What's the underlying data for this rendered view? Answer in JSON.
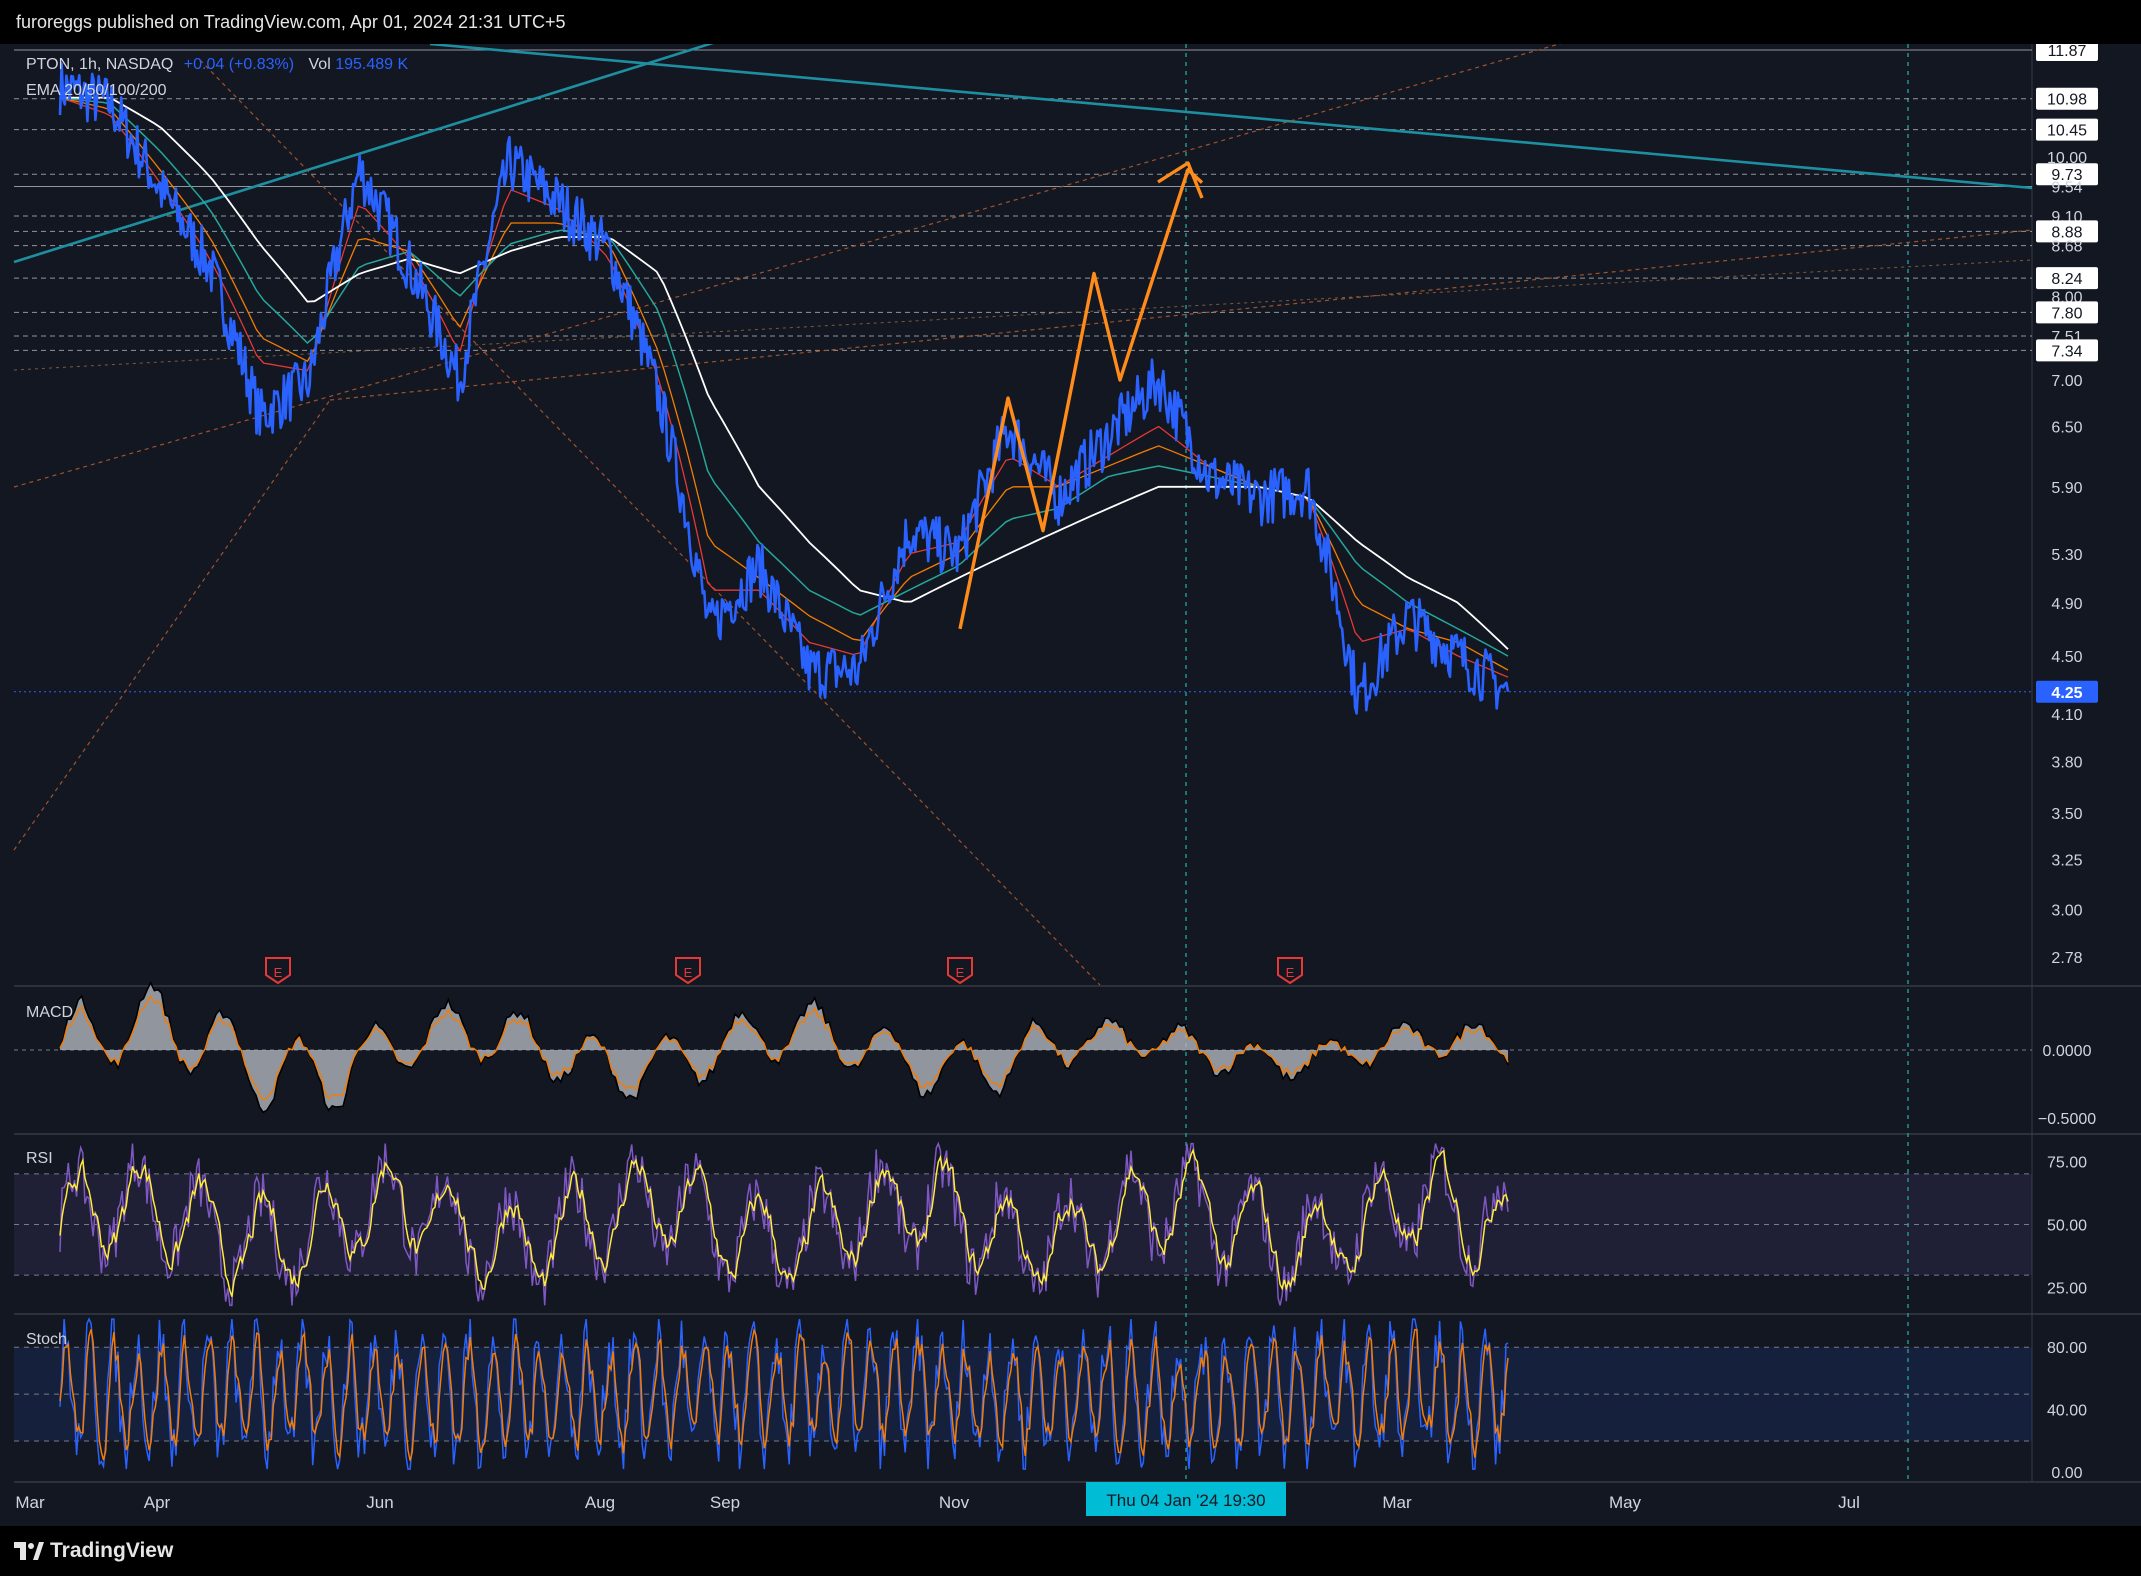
{
  "header": {
    "publisher_text": "furoreggs published on TradingView.com, Apr 01, 2024 21:31 UTC+5"
  },
  "footer": {
    "brand": "TradingView"
  },
  "legend": {
    "symbol": "PTON, 1h, NASDAQ",
    "change": "+0.04 (+0.83%)",
    "vol_label": "Vol",
    "vol_value": "195.489 K",
    "ema_label": "EMA 20/50/100/200"
  },
  "colors": {
    "background": "#131722",
    "price_line": "#2962ff",
    "ema20": "#e53935",
    "ema50": "#f57c00",
    "ema100": "#26a69a",
    "ema200": "#ffffff",
    "projection": "#ff8c1a",
    "trendline": "#1e8fa0",
    "rsi_line": "#7e57c2",
    "rsi_signal": "#ffeb3b",
    "stoch_k": "#2962ff",
    "stoch_d": "#f57c00",
    "macd_fill": "#b2b5be",
    "current_price_tag": "#2962ff",
    "crosshair_tag": "#00bcd4"
  },
  "chart_data": [
    {
      "type": "line",
      "pane": "price",
      "title": "PTON, 1h, NASDAQ",
      "x": [
        "Mar",
        "Apr",
        "Jun",
        "Aug",
        "Sep",
        "Nov",
        "Thu 04 Jan '24",
        "Mar",
        "May",
        "Jul"
      ],
      "x_tick_labels": [
        "Mar",
        "Apr",
        "Jun",
        "Aug",
        "Sep",
        "Nov",
        "Mar",
        "May",
        "Jul"
      ],
      "y_tick_labels": [
        "11.87",
        "10.98",
        "10.45",
        "10.00",
        "9.73",
        "9.54",
        "9.10",
        "8.88",
        "8.68",
        "8.24",
        "8.00",
        "7.80",
        "7.51",
        "7.34",
        "7.00",
        "6.50",
        "5.90",
        "5.30",
        "4.90",
        "4.50",
        "4.25",
        "4.10",
        "3.80",
        "3.50",
        "3.25",
        "3.00",
        "2.78"
      ],
      "boxed_price_labels": [
        "11.87",
        "10.98",
        "10.45",
        "9.73",
        "8.88",
        "8.24",
        "7.80",
        "7.34"
      ],
      "horizontal_levels": [
        11.87,
        10.98,
        10.45,
        9.73,
        9.54,
        9.1,
        8.88,
        8.68,
        8.24,
        7.8,
        7.51,
        7.34
      ],
      "ylim": [
        2.78,
        11.87
      ],
      "y_scale": "log",
      "current_price": "4.25",
      "crosshair_label": "Thu 04 Jan '24   19:30",
      "earnings_markers": [
        "E",
        "E",
        "E",
        "E"
      ],
      "price_series": {
        "name": "PTON",
        "x": [
          "Mar",
          "Apr",
          "Apr",
          "May",
          "May",
          "Jun",
          "Jun",
          "Jul",
          "Jul",
          "Aug",
          "Aug",
          "Aug",
          "Sep",
          "Sep",
          "Oct",
          "Oct",
          "Nov",
          "Nov",
          "Nov",
          "Dec",
          "Dec",
          "Jan",
          "Jan",
          "Jan",
          "Feb",
          "Feb",
          "Feb",
          "Mar",
          "Mar",
          "Mar"
        ],
        "values": [
          11.2,
          10.9,
          9.5,
          8.4,
          6.6,
          7.0,
          9.8,
          8.4,
          7.0,
          9.9,
          9.3,
          8.6,
          6.8,
          4.7,
          5.2,
          4.4,
          4.4,
          5.5,
          5.3,
          6.5,
          5.8,
          6.4,
          7.0,
          6.0,
          5.8,
          5.9,
          4.2,
          4.8,
          4.5,
          4.25
        ]
      },
      "ema_series": [
        {
          "name": "EMA 20",
          "values": [
            11.0,
            10.7,
            9.6,
            8.5,
            7.2,
            7.1,
            9.3,
            8.5,
            7.3,
            9.5,
            9.2,
            8.5,
            7.0,
            5.0,
            5.0,
            4.6,
            4.5,
            5.3,
            5.4,
            6.2,
            5.9,
            6.2,
            6.5,
            6.1,
            5.9,
            5.8,
            4.6,
            4.7,
            4.5,
            4.35
          ]
        },
        {
          "name": "EMA 50",
          "values": [
            11.0,
            10.8,
            9.8,
            8.8,
            7.5,
            7.2,
            8.8,
            8.6,
            7.6,
            9.0,
            9.0,
            8.7,
            7.3,
            5.4,
            5.1,
            4.8,
            4.6,
            5.1,
            5.3,
            5.9,
            5.9,
            6.1,
            6.3,
            6.1,
            5.9,
            5.8,
            4.9,
            4.7,
            4.6,
            4.4
          ]
        },
        {
          "name": "EMA 100",
          "values": [
            11.0,
            10.9,
            10.1,
            9.2,
            8.0,
            7.4,
            8.4,
            8.6,
            8.0,
            8.7,
            8.9,
            8.8,
            7.8,
            6.0,
            5.4,
            5.0,
            4.8,
            5.0,
            5.2,
            5.6,
            5.7,
            6.0,
            6.1,
            6.0,
            5.9,
            5.8,
            5.2,
            4.9,
            4.7,
            4.5
          ]
        },
        {
          "name": "EMA 200",
          "values": [
            11.0,
            11.0,
            10.5,
            9.7,
            8.7,
            7.9,
            8.3,
            8.5,
            8.3,
            8.6,
            8.8,
            8.8,
            8.3,
            6.8,
            5.9,
            5.4,
            5.0,
            4.9,
            5.1,
            5.3,
            5.5,
            5.7,
            5.9,
            5.9,
            5.9,
            5.8,
            5.4,
            5.1,
            4.9,
            4.55
          ]
        }
      ],
      "projection_path": [
        4.7,
        6.8,
        5.5,
        8.3,
        7.0,
        9.8,
        9.6
      ]
    },
    {
      "type": "area",
      "pane": "MACD",
      "title": "MACD",
      "y_tick_labels": [
        "0.0000",
        "−0.5000"
      ],
      "ylim": [
        -0.5,
        0.3
      ]
    },
    {
      "type": "line",
      "pane": "RSI",
      "title": "RSI",
      "y_tick_labels": [
        "75.00",
        "50.00",
        "25.00"
      ],
      "ylim": [
        15,
        85
      ],
      "band": [
        30,
        70
      ]
    },
    {
      "type": "line",
      "pane": "Stoch",
      "title": "Stoch",
      "y_tick_labels": [
        "80.00",
        "40.00",
        "0.00"
      ],
      "ylim": [
        -5,
        100
      ],
      "band": [
        20,
        80
      ]
    }
  ]
}
